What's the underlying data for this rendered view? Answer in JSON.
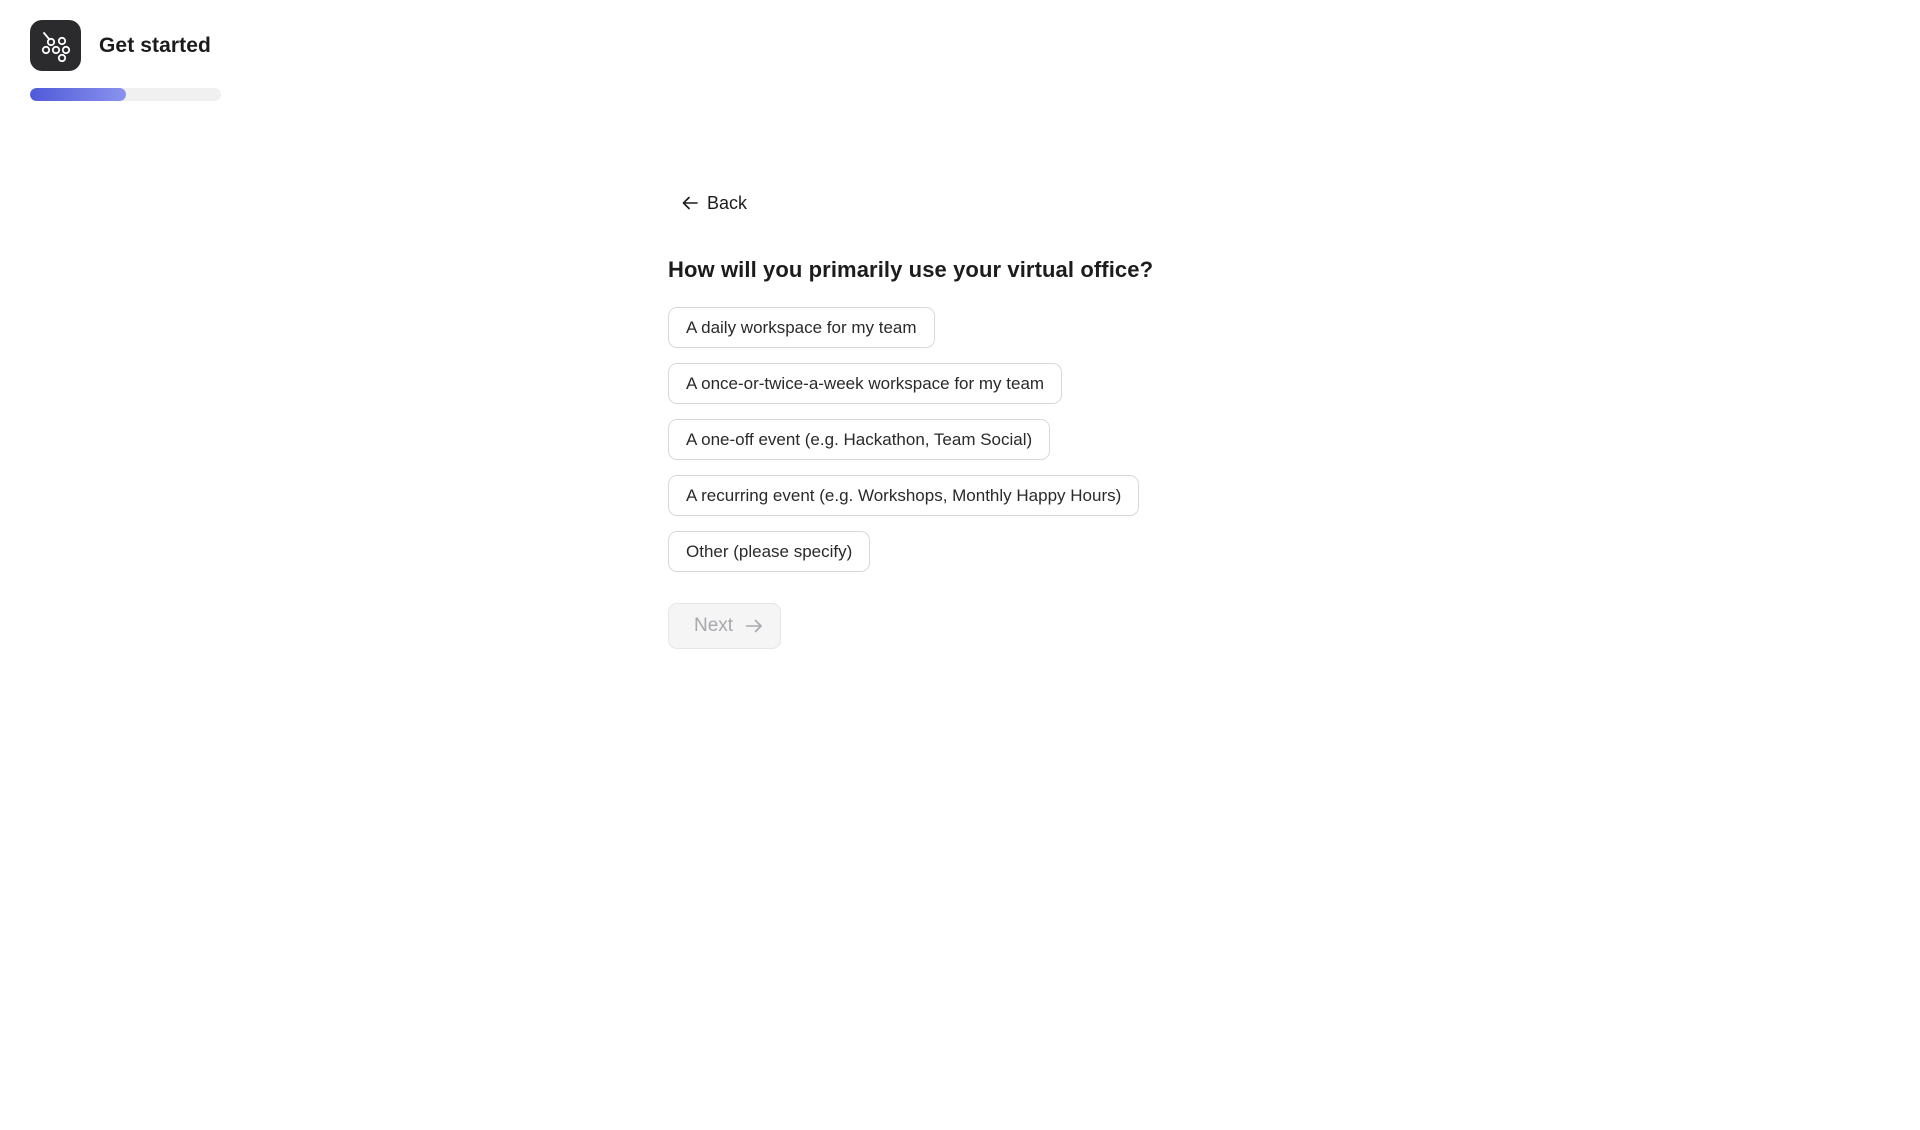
{
  "header": {
    "title": "Get started",
    "logo_icon": "bubbles-logo-icon",
    "progress_percent": 50
  },
  "main": {
    "back_label": "Back",
    "question": "How will you primarily use your virtual office?",
    "options": [
      {
        "label": "A daily workspace for my team"
      },
      {
        "label": "A once-or-twice-a-week workspace for my team"
      },
      {
        "label": "A one-off event (e.g. Hackathon, Team Social)"
      },
      {
        "label": "A recurring event (e.g. Workshops, Monthly Happy Hours)"
      },
      {
        "label": "Other (please specify)"
      }
    ],
    "next_label": "Next",
    "next_disabled": true
  },
  "colors": {
    "accent": "#4f5ad8",
    "logo_bg": "#2b2b2d",
    "text": "#1c1c1e",
    "border": "#d9d9dc",
    "disabled_text": "#a8a8ad"
  }
}
